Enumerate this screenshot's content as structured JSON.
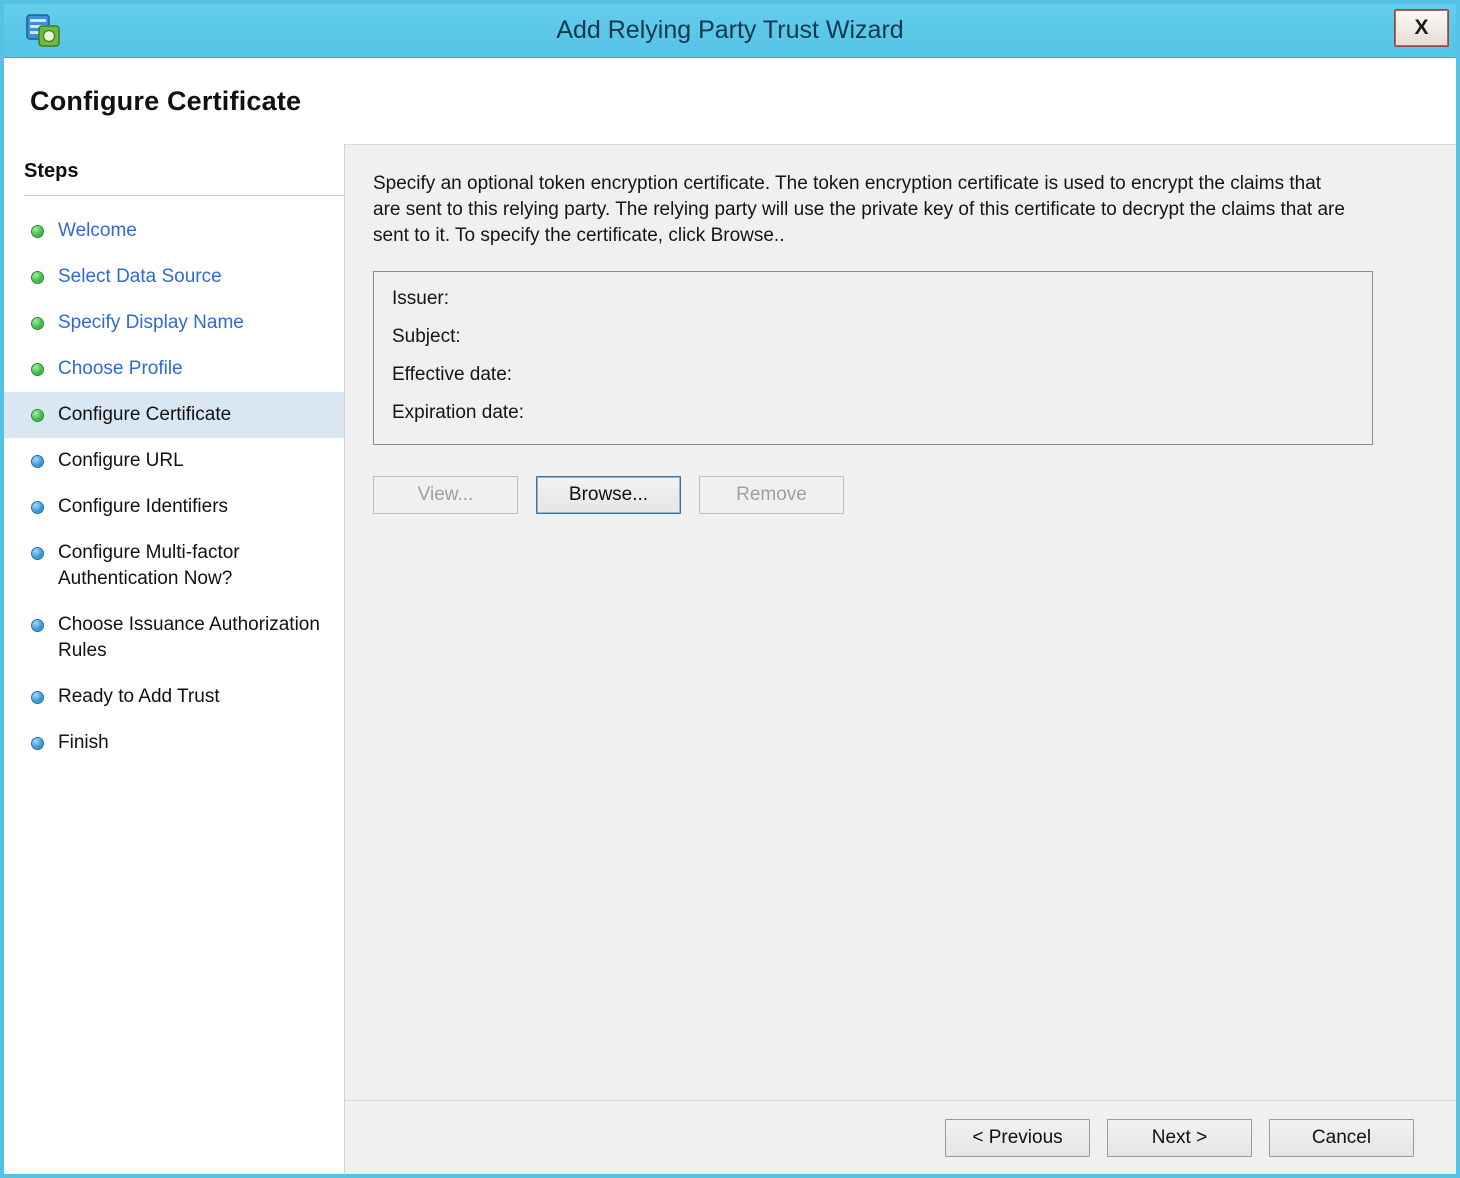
{
  "window": {
    "title": "Add Relying Party Trust Wizard",
    "close_label": "X"
  },
  "page": {
    "title": "Configure Certificate"
  },
  "steps": {
    "heading": "Steps",
    "items": [
      {
        "label": "Welcome",
        "state": "completed"
      },
      {
        "label": "Select Data Source",
        "state": "completed"
      },
      {
        "label": "Specify Display Name",
        "state": "completed"
      },
      {
        "label": "Choose Profile",
        "state": "completed"
      },
      {
        "label": "Configure Certificate",
        "state": "current"
      },
      {
        "label": "Configure URL",
        "state": "upcoming"
      },
      {
        "label": "Configure Identifiers",
        "state": "upcoming"
      },
      {
        "label": "Configure Multi-factor Authentication Now?",
        "state": "upcoming"
      },
      {
        "label": "Choose Issuance Authorization Rules",
        "state": "upcoming"
      },
      {
        "label": "Ready to Add Trust",
        "state": "upcoming"
      },
      {
        "label": "Finish",
        "state": "upcoming"
      }
    ]
  },
  "content": {
    "description": "Specify an optional token encryption certificate.  The token encryption certificate is used to encrypt the claims that are sent to this relying party.  The relying party will use the private key of this certificate to decrypt the claims that are sent to it.  To specify the certificate, click Browse..",
    "certificate_fields": [
      {
        "label": "Issuer:",
        "value": ""
      },
      {
        "label": "Subject:",
        "value": ""
      },
      {
        "label": "Effective date:",
        "value": ""
      },
      {
        "label": "Expiration date:",
        "value": ""
      }
    ],
    "buttons": {
      "view": "View...",
      "browse": "Browse...",
      "remove": "Remove"
    }
  },
  "footer": {
    "previous": "< Previous",
    "next": "Next >",
    "cancel": "Cancel"
  },
  "colors": {
    "titlebar": "#5bc7e9",
    "link": "#2e6bd2",
    "current_step_bg": "#d9e7f3",
    "bullet_done": "#2fae38",
    "bullet_todo": "#2384c6",
    "content_bg": "#f0f0f0"
  }
}
